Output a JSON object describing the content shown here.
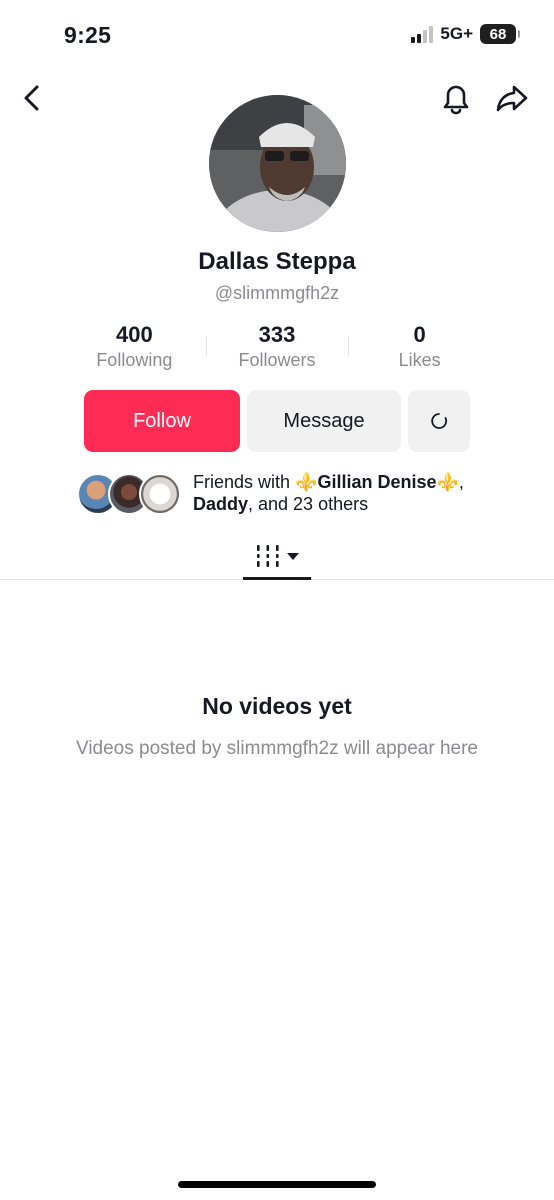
{
  "status_bar": {
    "time": "9:25",
    "network": "5G+",
    "battery": "68"
  },
  "nav": {
    "back_icon": "chevron-left-icon",
    "bell_icon": "bell-icon",
    "share_icon": "share-arrow-icon"
  },
  "profile": {
    "display_name": "Dallas Steppa",
    "username": "@slimmmgfh2z"
  },
  "stats": [
    {
      "value": "400",
      "label": "Following"
    },
    {
      "value": "333",
      "label": "Followers"
    },
    {
      "value": "0",
      "label": "Likes"
    }
  ],
  "actions": {
    "follow_label": "Follow",
    "message_label": "Message",
    "more_icon": "loading-ring-icon"
  },
  "friends": {
    "prefix": "Friends with ",
    "friend1": "⚜️Gillian Denise⚜️",
    "separator": ",",
    "friend2": "Daddy",
    "suffix": ", and 23 others"
  },
  "tabs": {
    "active_icon": "videos-grid-icon",
    "dropdown_icon": "caret-down-icon"
  },
  "empty_state": {
    "title": "No videos yet",
    "subtitle": "Videos posted by slimmmgfh2z will appear here"
  },
  "colors": {
    "accent": "#fe2c55",
    "text": "#161823",
    "muted": "#8a8b91",
    "button_bg": "#f1f1f2"
  }
}
